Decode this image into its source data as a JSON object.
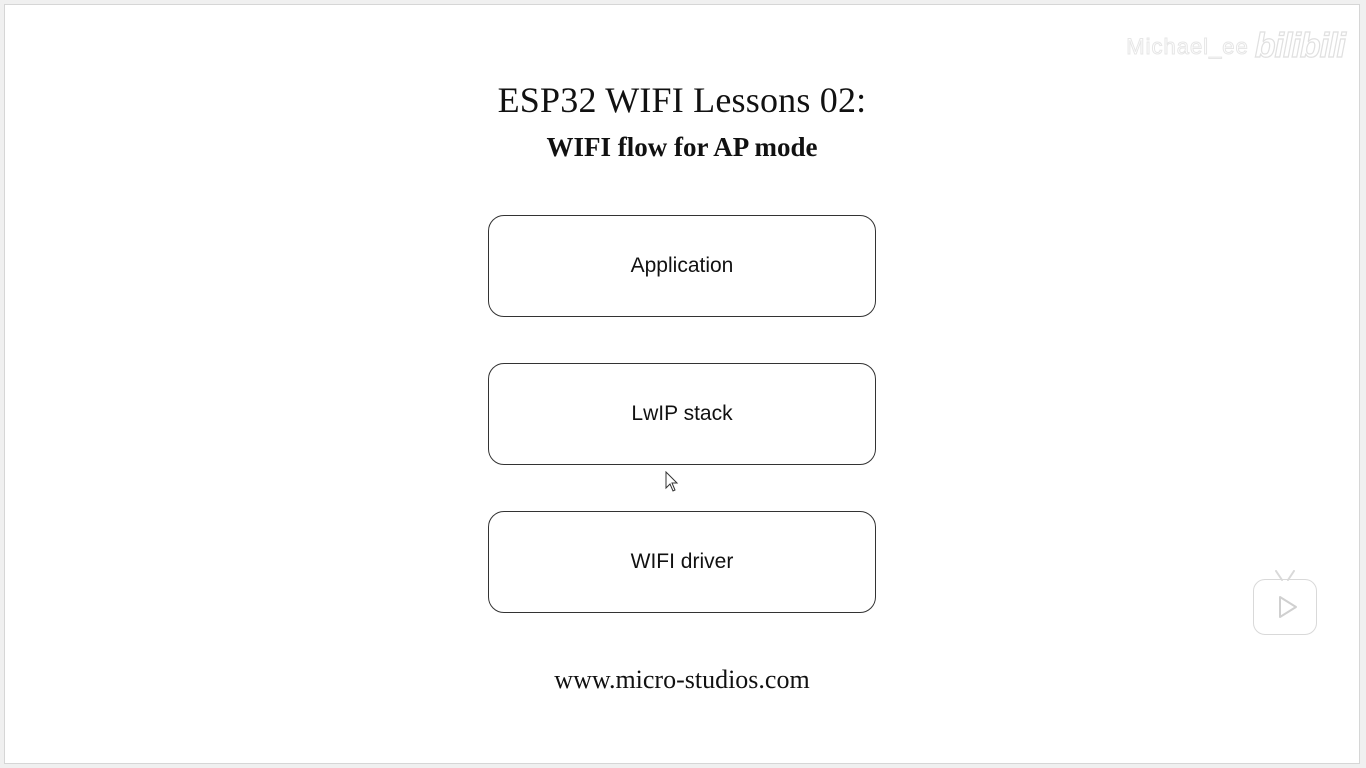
{
  "slide": {
    "title": "ESP32 WIFI Lessons 02:",
    "subtitle": "WIFI flow for AP mode",
    "boxes": [
      {
        "label": "Application"
      },
      {
        "label": "LwIP stack"
      },
      {
        "label": "WIFI driver"
      }
    ],
    "website": "www.micro-studios.com"
  },
  "watermark": {
    "user": "Michael_ee",
    "logo": "bilibili"
  },
  "overlay": {
    "play_icon": "play-icon"
  }
}
